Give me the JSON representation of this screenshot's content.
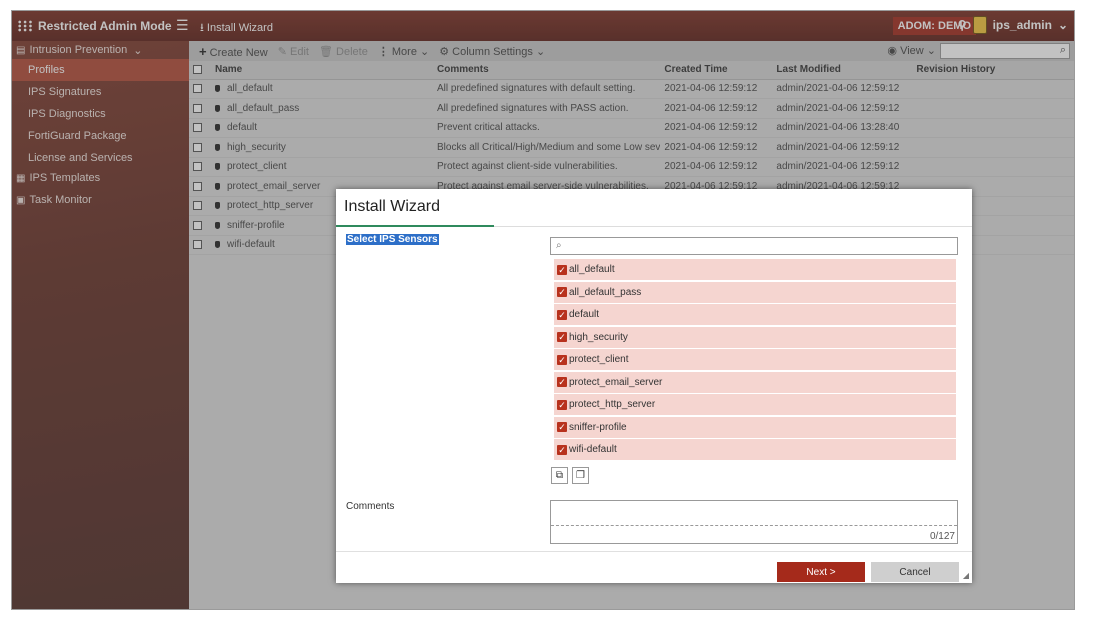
{
  "topbar": {
    "brand": "Restricted Admin Mode",
    "page_heading": "Install Wizard",
    "adom": "ADOM: DEMO",
    "username": "ips_admin"
  },
  "sidebar": {
    "section": "Intrusion Prevention",
    "items": [
      "Profiles",
      "IPS Signatures",
      "IPS Diagnostics",
      "FortiGuard Package",
      "License and Services"
    ],
    "section2": "IPS Templates",
    "section3": "Task Monitor"
  },
  "toolbar": {
    "create_new": "Create New",
    "edit": "Edit",
    "delete": "Delete",
    "more": "More",
    "column_settings": "Column Settings",
    "view": "View"
  },
  "table": {
    "columns": [
      "Name",
      "Comments",
      "Created Time",
      "Last Modified",
      "Revision History"
    ],
    "rows": [
      {
        "name": "all_default",
        "comment": "All predefined signatures with default setting.",
        "created": "2021-04-06 12:59:12",
        "modified": "admin/2021-04-06 12:59:12"
      },
      {
        "name": "all_default_pass",
        "comment": "All predefined signatures with PASS action.",
        "created": "2021-04-06 12:59:12",
        "modified": "admin/2021-04-06 12:59:12"
      },
      {
        "name": "default",
        "comment": "Prevent critical attacks.",
        "created": "2021-04-06 12:59:12",
        "modified": "admin/2021-04-06 13:28:40"
      },
      {
        "name": "high_security",
        "comment": "Blocks all Critical/High/Medium and some Low sev",
        "created": "2021-04-06 12:59:12",
        "modified": "admin/2021-04-06 12:59:12"
      },
      {
        "name": "protect_client",
        "comment": "Protect against client-side vulnerabilities.",
        "created": "2021-04-06 12:59:12",
        "modified": "admin/2021-04-06 12:59:12"
      },
      {
        "name": "protect_email_server",
        "comment": "Protect against email server-side vulnerabilities.",
        "created": "2021-04-06 12:59:12",
        "modified": "admin/2021-04-06 12:59:12"
      },
      {
        "name": "protect_http_server",
        "comment": "",
        "created": "",
        "modified": ""
      },
      {
        "name": "sniffer-profile",
        "comment": "",
        "created": "",
        "modified": ""
      },
      {
        "name": "wifi-default",
        "comment": "",
        "created": "",
        "modified": ""
      }
    ]
  },
  "modal": {
    "title": "Install Wizard",
    "sensors_label": "Select IPS Sensors",
    "sensors": [
      "all_default",
      "all_default_pass",
      "default",
      "high_security",
      "protect_client",
      "protect_email_server",
      "protect_http_server",
      "sniffer-profile",
      "wifi-default"
    ],
    "comments_label": "Comments",
    "char_count": "0/127",
    "next_label": "Next >",
    "cancel_label": "Cancel"
  },
  "colors": {
    "topbar": "#6b2619",
    "accent": "#a52a1b",
    "selected_item_bg": "#f5d5d0",
    "tab_accent": "#2f8a5d"
  }
}
